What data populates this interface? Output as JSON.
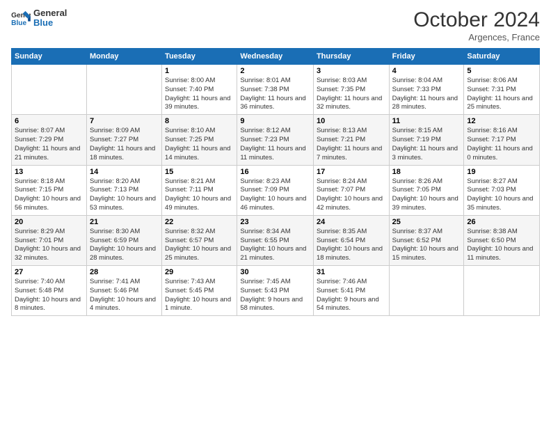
{
  "header": {
    "logo_line1": "General",
    "logo_line2": "Blue",
    "month": "October 2024",
    "location": "Argences, France"
  },
  "weekdays": [
    "Sunday",
    "Monday",
    "Tuesday",
    "Wednesday",
    "Thursday",
    "Friday",
    "Saturday"
  ],
  "weeks": [
    [
      {
        "day": "",
        "info": ""
      },
      {
        "day": "",
        "info": ""
      },
      {
        "day": "1",
        "info": "Sunrise: 8:00 AM\nSunset: 7:40 PM\nDaylight: 11 hours and 39 minutes."
      },
      {
        "day": "2",
        "info": "Sunrise: 8:01 AM\nSunset: 7:38 PM\nDaylight: 11 hours and 36 minutes."
      },
      {
        "day": "3",
        "info": "Sunrise: 8:03 AM\nSunset: 7:35 PM\nDaylight: 11 hours and 32 minutes."
      },
      {
        "day": "4",
        "info": "Sunrise: 8:04 AM\nSunset: 7:33 PM\nDaylight: 11 hours and 28 minutes."
      },
      {
        "day": "5",
        "info": "Sunrise: 8:06 AM\nSunset: 7:31 PM\nDaylight: 11 hours and 25 minutes."
      }
    ],
    [
      {
        "day": "6",
        "info": "Sunrise: 8:07 AM\nSunset: 7:29 PM\nDaylight: 11 hours and 21 minutes."
      },
      {
        "day": "7",
        "info": "Sunrise: 8:09 AM\nSunset: 7:27 PM\nDaylight: 11 hours and 18 minutes."
      },
      {
        "day": "8",
        "info": "Sunrise: 8:10 AM\nSunset: 7:25 PM\nDaylight: 11 hours and 14 minutes."
      },
      {
        "day": "9",
        "info": "Sunrise: 8:12 AM\nSunset: 7:23 PM\nDaylight: 11 hours and 11 minutes."
      },
      {
        "day": "10",
        "info": "Sunrise: 8:13 AM\nSunset: 7:21 PM\nDaylight: 11 hours and 7 minutes."
      },
      {
        "day": "11",
        "info": "Sunrise: 8:15 AM\nSunset: 7:19 PM\nDaylight: 11 hours and 3 minutes."
      },
      {
        "day": "12",
        "info": "Sunrise: 8:16 AM\nSunset: 7:17 PM\nDaylight: 11 hours and 0 minutes."
      }
    ],
    [
      {
        "day": "13",
        "info": "Sunrise: 8:18 AM\nSunset: 7:15 PM\nDaylight: 10 hours and 56 minutes."
      },
      {
        "day": "14",
        "info": "Sunrise: 8:20 AM\nSunset: 7:13 PM\nDaylight: 10 hours and 53 minutes."
      },
      {
        "day": "15",
        "info": "Sunrise: 8:21 AM\nSunset: 7:11 PM\nDaylight: 10 hours and 49 minutes."
      },
      {
        "day": "16",
        "info": "Sunrise: 8:23 AM\nSunset: 7:09 PM\nDaylight: 10 hours and 46 minutes."
      },
      {
        "day": "17",
        "info": "Sunrise: 8:24 AM\nSunset: 7:07 PM\nDaylight: 10 hours and 42 minutes."
      },
      {
        "day": "18",
        "info": "Sunrise: 8:26 AM\nSunset: 7:05 PM\nDaylight: 10 hours and 39 minutes."
      },
      {
        "day": "19",
        "info": "Sunrise: 8:27 AM\nSunset: 7:03 PM\nDaylight: 10 hours and 35 minutes."
      }
    ],
    [
      {
        "day": "20",
        "info": "Sunrise: 8:29 AM\nSunset: 7:01 PM\nDaylight: 10 hours and 32 minutes."
      },
      {
        "day": "21",
        "info": "Sunrise: 8:30 AM\nSunset: 6:59 PM\nDaylight: 10 hours and 28 minutes."
      },
      {
        "day": "22",
        "info": "Sunrise: 8:32 AM\nSunset: 6:57 PM\nDaylight: 10 hours and 25 minutes."
      },
      {
        "day": "23",
        "info": "Sunrise: 8:34 AM\nSunset: 6:55 PM\nDaylight: 10 hours and 21 minutes."
      },
      {
        "day": "24",
        "info": "Sunrise: 8:35 AM\nSunset: 6:54 PM\nDaylight: 10 hours and 18 minutes."
      },
      {
        "day": "25",
        "info": "Sunrise: 8:37 AM\nSunset: 6:52 PM\nDaylight: 10 hours and 15 minutes."
      },
      {
        "day": "26",
        "info": "Sunrise: 8:38 AM\nSunset: 6:50 PM\nDaylight: 10 hours and 11 minutes."
      }
    ],
    [
      {
        "day": "27",
        "info": "Sunrise: 7:40 AM\nSunset: 5:48 PM\nDaylight: 10 hours and 8 minutes."
      },
      {
        "day": "28",
        "info": "Sunrise: 7:41 AM\nSunset: 5:46 PM\nDaylight: 10 hours and 4 minutes."
      },
      {
        "day": "29",
        "info": "Sunrise: 7:43 AM\nSunset: 5:45 PM\nDaylight: 10 hours and 1 minute."
      },
      {
        "day": "30",
        "info": "Sunrise: 7:45 AM\nSunset: 5:43 PM\nDaylight: 9 hours and 58 minutes."
      },
      {
        "day": "31",
        "info": "Sunrise: 7:46 AM\nSunset: 5:41 PM\nDaylight: 9 hours and 54 minutes."
      },
      {
        "day": "",
        "info": ""
      },
      {
        "day": "",
        "info": ""
      }
    ]
  ]
}
